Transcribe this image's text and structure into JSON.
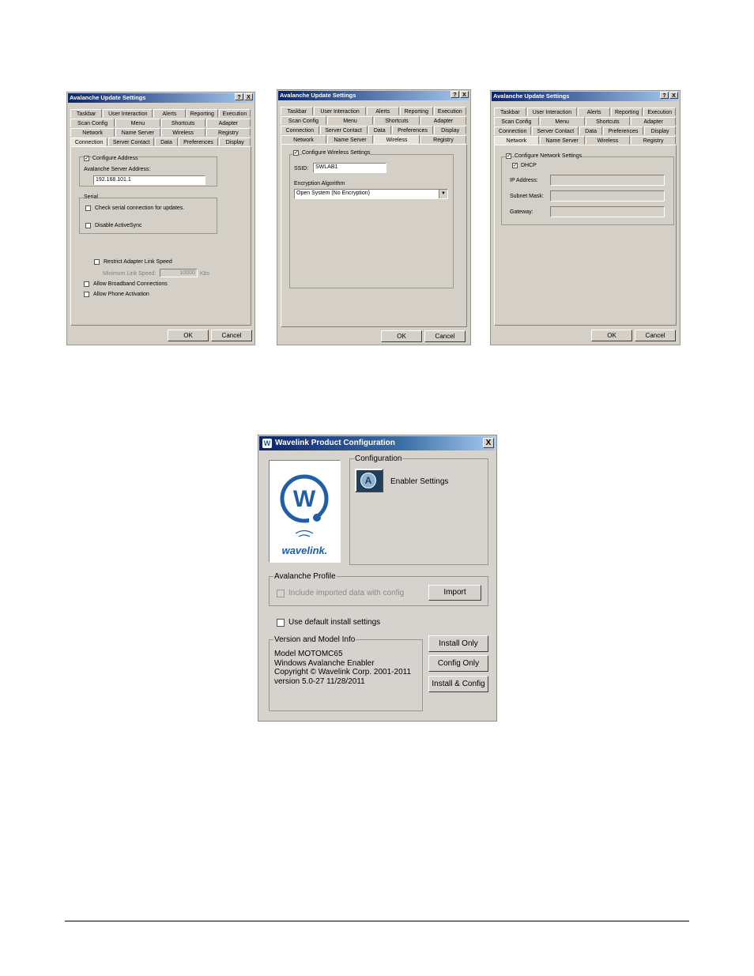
{
  "dialogs": {
    "title": "Avalanche Update Settings",
    "help_label": "?",
    "close_label": "X",
    "tabs_row1": [
      "Taskbar",
      "User Interaction",
      "Alerts",
      "Reporting",
      "Execution"
    ],
    "tabs_row2": [
      "Scan Config",
      "Menu",
      "Shortcuts",
      "Adapter"
    ],
    "tabs_row3": [
      "Network",
      "Name Server",
      "Wireless",
      "Registry"
    ],
    "tabs_row4": [
      "Connection",
      "Server Contact",
      "Data",
      "Preferences",
      "Display"
    ],
    "ok_label": "OK",
    "cancel_label": "Cancel"
  },
  "connection": {
    "configure_address": "Configure Address",
    "server_address_label": "Avalanche Server Address:",
    "server_address_value": "192.168.101.1",
    "serial_group": "Serial",
    "check_serial": "Check serial connection for updates.",
    "disable_activesync": "Disable ActiveSync",
    "restrict_speed": "Restrict Adapter Link Speed",
    "min_speed_label": "Minimum Link Speed:",
    "min_speed_value": "10000",
    "min_speed_unit": "Kbs",
    "allow_broadband": "Allow Broadband Connections",
    "allow_phone": "Allow Phone Activation"
  },
  "wireless": {
    "configure": "Configure Wireless Settings",
    "ssid_label": "SSID:",
    "ssid_value": "SWLAB1",
    "encryption_label": "Encryption Algorithm",
    "encryption_value": "Open System (No Encryption)"
  },
  "network": {
    "configure": "Configure Network Settings",
    "dhcp": "DHCP",
    "ip_label": "IP Address:",
    "subnet_label": "Subnet Mask:",
    "gateway_label": "Gateway:"
  },
  "wavelink": {
    "title": "Wavelink Product Configuration",
    "close_label": "X",
    "logo_text": "wavelink.",
    "config_group": "Configuration",
    "enabler_settings": "Enabler Settings",
    "profile_group": "Avalanche Profile",
    "include_imported": "Include imported data with config",
    "import_label": "Import",
    "use_default": "Use default install settings",
    "version_group": "Version and Model Info",
    "version_lines": [
      "Model MOTOMC65",
      "Windows Avalanche Enabler",
      "Copyright © Wavelink Corp. 2001-2011",
      "version 5.0-27 11/28/2011"
    ],
    "install_only": "Install Only",
    "config_only": "Config Only",
    "install_config": "Install & Config"
  }
}
